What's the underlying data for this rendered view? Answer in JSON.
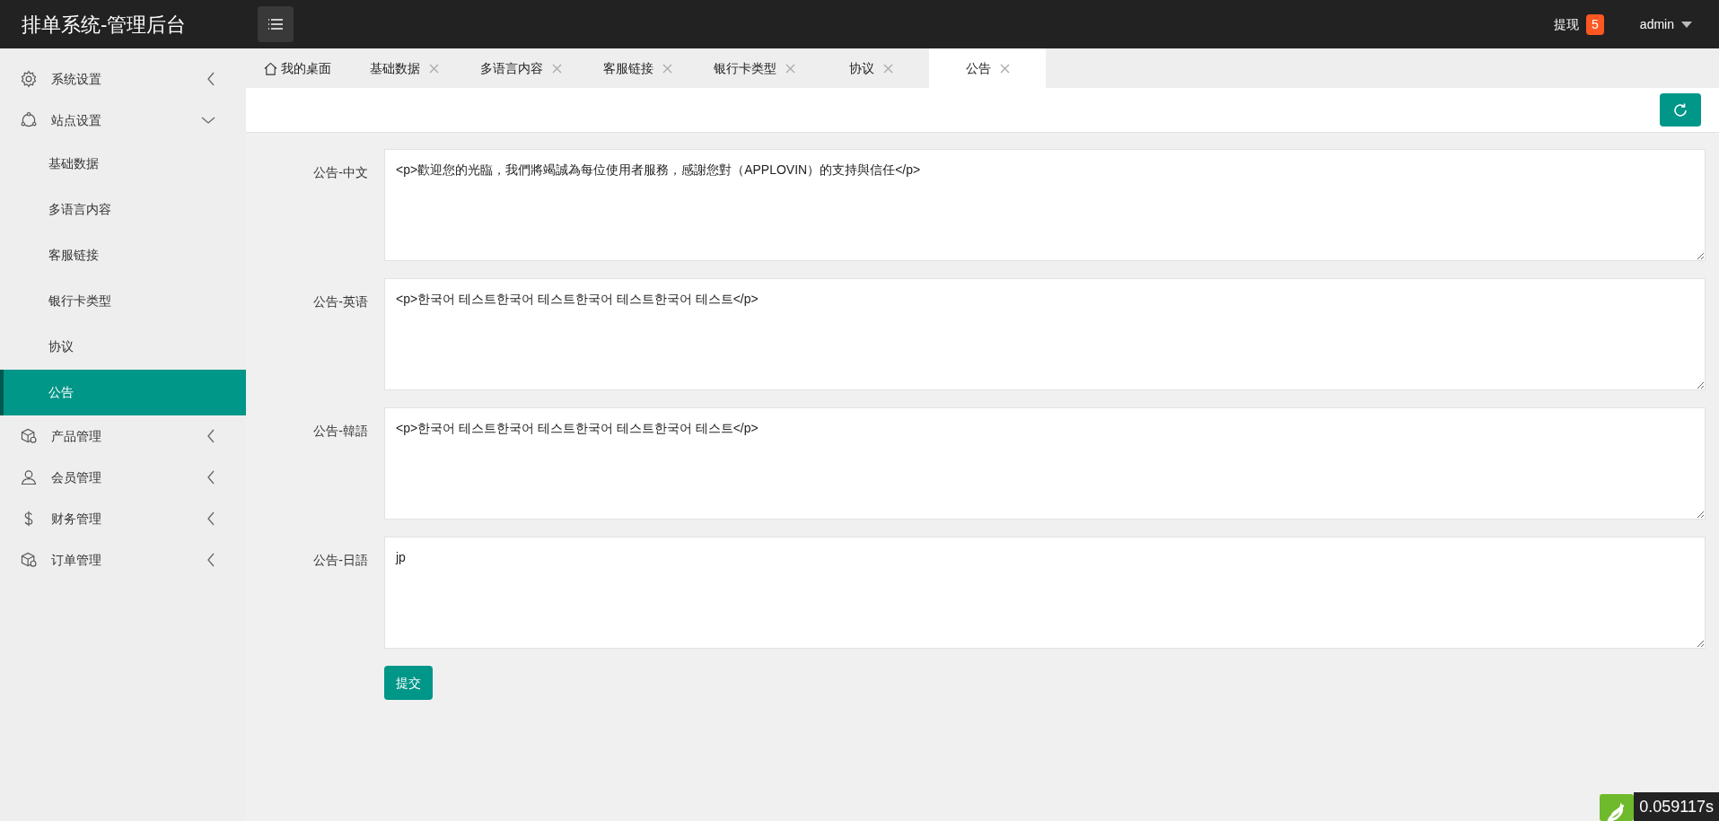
{
  "header": {
    "title": "排单系统-管理后台",
    "withdraw_label": "提现",
    "withdraw_count": "5",
    "user": "admin"
  },
  "sidebar": {
    "items": [
      {
        "label": "系统设置",
        "expanded": false
      },
      {
        "label": "站点设置",
        "expanded": true,
        "children": [
          {
            "label": "基础数据",
            "selected": false
          },
          {
            "label": "多语言内容",
            "selected": false
          },
          {
            "label": "客服链接",
            "selected": false
          },
          {
            "label": "银行卡类型",
            "selected": false
          },
          {
            "label": "协议",
            "selected": false
          },
          {
            "label": "公告",
            "selected": true
          }
        ]
      },
      {
        "label": "产品管理",
        "expanded": false
      },
      {
        "label": "会员管理",
        "expanded": false
      },
      {
        "label": "财务管理",
        "expanded": false
      },
      {
        "label": "订单管理",
        "expanded": false
      }
    ]
  },
  "tabs": [
    {
      "label": "我的桌面",
      "kind": "home",
      "selected": false
    },
    {
      "label": "基础数据",
      "kind": "closable",
      "selected": false
    },
    {
      "label": "多语言内容",
      "kind": "closable",
      "selected": false
    },
    {
      "label": "客服链接",
      "kind": "closable",
      "selected": false
    },
    {
      "label": "银行卡类型",
      "kind": "closable",
      "selected": false
    },
    {
      "label": "协议",
      "kind": "closable",
      "selected": false
    },
    {
      "label": "公告",
      "kind": "closable",
      "selected": true
    }
  ],
  "form": {
    "fields": [
      {
        "label": "公告-中文",
        "value": "<p>歡迎您的光臨，我們將竭誠為每位使用者服務，感謝您對（APPLOVIN）的支持與信任</p>"
      },
      {
        "label": "公告-英语",
        "value": "<p>한국어 테스트한국어 테스트한국어 테스트한국어 테스트</p>"
      },
      {
        "label": "公告-韓語",
        "value": "<p>한국어 테스트한국어 테스트한국어 테스트한국어 테스트</p>"
      },
      {
        "label": "公告-日語",
        "value": "jp"
      }
    ],
    "submit": "提交"
  },
  "debug_bar": {
    "time": "0.059117s"
  }
}
